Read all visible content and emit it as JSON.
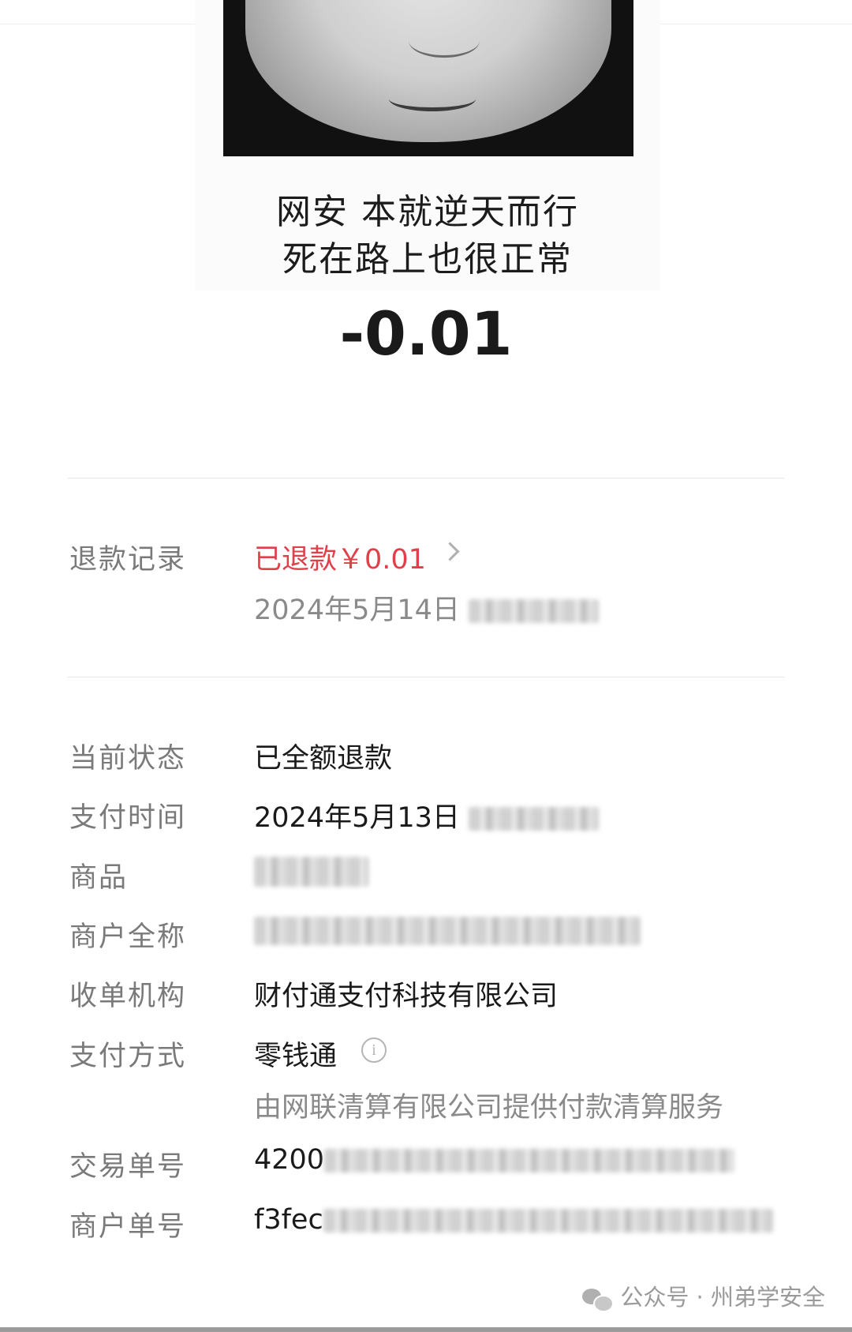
{
  "meme": {
    "caption_line1": "网安 本就逆天而行",
    "caption_line2": "死在路上也很正常"
  },
  "amount": "-0.01",
  "refund": {
    "label": "退款记录",
    "status_text": "已退款￥0.01",
    "date": "2024年5月14日"
  },
  "details": {
    "status_label": "当前状态",
    "status_value": "已全额退款",
    "pay_time_label": "支付时间",
    "pay_time_value": "2024年5月13日",
    "product_label": "商品",
    "merchant_label": "商户全称",
    "acquirer_label": "收单机构",
    "acquirer_value": "财付通支付科技有限公司",
    "pay_method_label": "支付方式",
    "pay_method_value": "零钱通",
    "clearing_note": "由网联清算有限公司提供付款清算服务",
    "transaction_no_label": "交易单号",
    "transaction_no_prefix": "4200",
    "merchant_no_label": "商户单号",
    "merchant_no_prefix": "f3fec"
  },
  "footer": {
    "text": "公众号 · 州弟学安全"
  },
  "colors": {
    "refund_red": "#e0404a",
    "label_grey": "#7a7a7a",
    "text_dark": "#1a1a1a"
  },
  "icons": [
    "chevron-right-icon",
    "info-icon",
    "wechat-icon"
  ]
}
